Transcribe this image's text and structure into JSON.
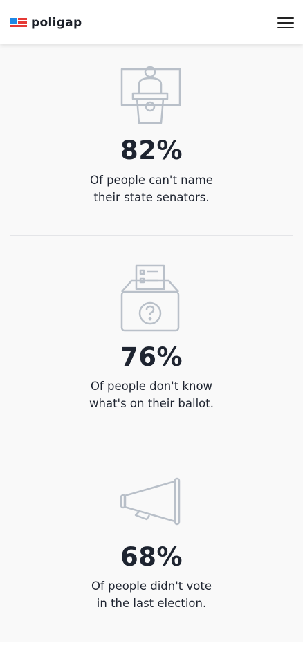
{
  "header": {
    "brand": "poligap",
    "menu_icon": "hamburger-menu-icon",
    "colors": {
      "brand_blue": "#1e88e5",
      "brand_red": "#e53935"
    }
  },
  "stats": [
    {
      "icon": "podium-icon",
      "value": "82%",
      "line1": "Of people can't name",
      "line2": "their state senators."
    },
    {
      "icon": "ballot-box-icon",
      "value": "76%",
      "line1": "Of people don't know",
      "line2": "what's on their ballot."
    },
    {
      "icon": "megaphone-icon",
      "value": "68%",
      "line1": "Of people didn't vote",
      "line2": "in the last election."
    }
  ],
  "icon_color": "#b9c0c9"
}
